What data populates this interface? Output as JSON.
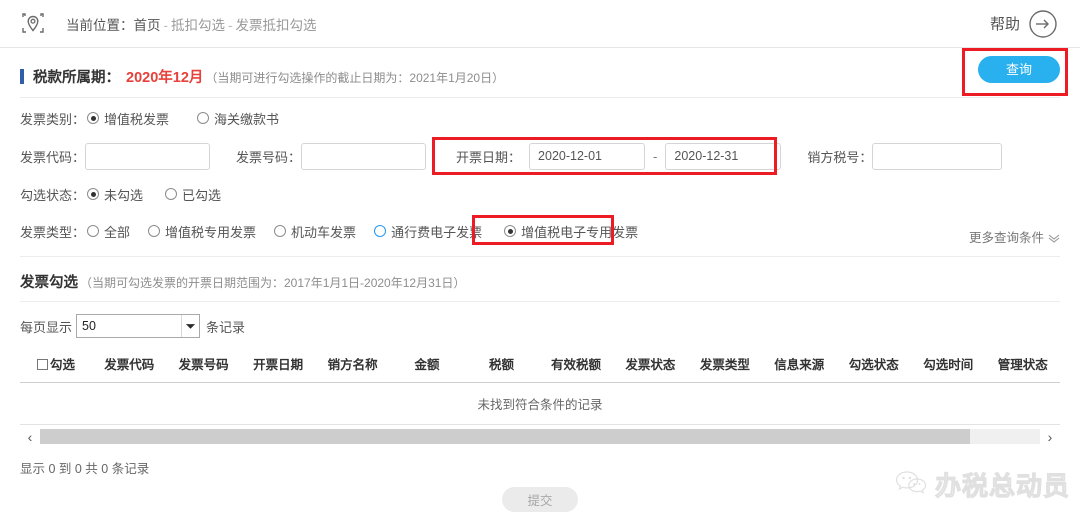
{
  "header": {
    "pin_icon": "location-pin-icon",
    "breadcrumb_label": "当前位置：",
    "breadcrumb_home": "首页",
    "breadcrumb_sep": "-",
    "breadcrumb_mid": "抵扣勾选",
    "breadcrumb_last": "发票抵扣勾选",
    "help_label": "帮助",
    "help_icon": "arrow-right-circle-icon"
  },
  "period": {
    "label": "税款所属期：",
    "value": "2020年12月",
    "note": "（当期可进行勾选操作的截止日期为：2021年1月20日）",
    "query_button": "查询"
  },
  "form": {
    "category": {
      "label": "发票类别：",
      "options": [
        {
          "label": "增值税发票",
          "checked": true
        },
        {
          "label": "海关缴款书",
          "checked": false
        }
      ]
    },
    "invoice_code": {
      "label": "发票代码：",
      "value": "",
      "placeholder": ""
    },
    "invoice_number": {
      "label": "发票号码：",
      "value": "",
      "placeholder": ""
    },
    "invoice_date": {
      "label": "开票日期：",
      "start": "2020-12-01",
      "separator": "-",
      "end": "2020-12-31"
    },
    "seller_tax_no": {
      "label": "销方税号：",
      "value": "",
      "placeholder": ""
    },
    "check_status": {
      "label": "勾选状态：",
      "options": [
        {
          "label": "未勾选",
          "checked": true
        },
        {
          "label": "已勾选",
          "checked": false
        }
      ]
    },
    "invoice_type": {
      "label": "发票类型：",
      "options": [
        {
          "label": "全部",
          "checked": false,
          "accent": false
        },
        {
          "label": "增值税专用发票",
          "checked": false,
          "accent": false
        },
        {
          "label": "机动车发票",
          "checked": false,
          "accent": false
        },
        {
          "label": "通行费电子发票",
          "checked": false,
          "accent": true
        },
        {
          "label": "增值税电子专用发票",
          "checked": true,
          "accent": false
        }
      ]
    },
    "more_conditions": "更多查询条件"
  },
  "list": {
    "title": "发票勾选",
    "title_note": "（当期可勾选发票的开票日期范围为：2017年1月1日-2020年12月31日）",
    "pagesize_prefix": "每页显示",
    "pagesize_value": "50",
    "pagesize_suffix": "条记录",
    "columns": [
      "勾选",
      "发票代码",
      "发票号码",
      "开票日期",
      "销方名称",
      "金额",
      "税额",
      "有效税额",
      "发票状态",
      "发票类型",
      "信息来源",
      "勾选状态",
      "勾选时间",
      "管理状态"
    ],
    "empty_text": "未找到符合条件的记录",
    "scroll_left_icon": "chevron-left-icon",
    "scroll_right_icon": "chevron-right-icon",
    "footer_info": "显示 0 到 0 共 0 条记录",
    "submit_button": "提交"
  },
  "watermark": {
    "icon": "wechat-icon",
    "text": "办税总动员"
  },
  "colors": {
    "accent_blue": "#28b0ef",
    "highlight_red": "#ed1c24",
    "period_red": "#e8403a",
    "title_bar_blue": "#2f5fa8"
  }
}
